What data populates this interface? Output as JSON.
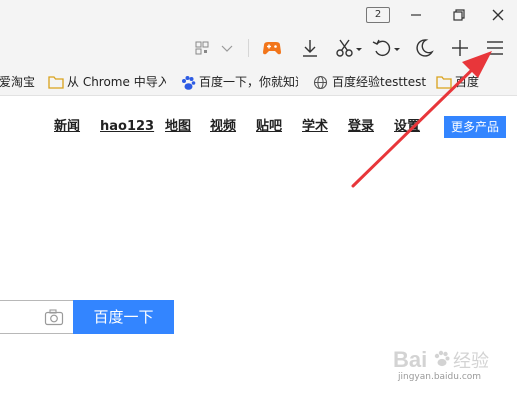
{
  "titlebar": {
    "tab_count": "2"
  },
  "bookmarks": [
    {
      "label": "爱淘宝",
      "icon": "taobao-fav-icon"
    },
    {
      "label": "从 Chrome 中导入",
      "icon": "folder-icon"
    },
    {
      "label": "百度一下，你就知道",
      "icon": "baidu-paw-icon"
    },
    {
      "label": "百度经验testtest",
      "icon": "globe-icon"
    },
    {
      "label": "百度",
      "icon": "folder-icon"
    }
  ],
  "nav": {
    "items": [
      "新闻",
      "hao123",
      "地图",
      "视频",
      "贴吧",
      "学术",
      "登录",
      "设置"
    ],
    "more": "更多产品"
  },
  "search": {
    "button": "百度一下"
  },
  "watermark": {
    "brand": "Bai",
    "brand2": "经验",
    "url": "jingyan.baidu.com"
  },
  "colors": {
    "accent": "#3385ff",
    "annotation": "#e8363a",
    "chrome_bg": "#f4f4f4"
  }
}
